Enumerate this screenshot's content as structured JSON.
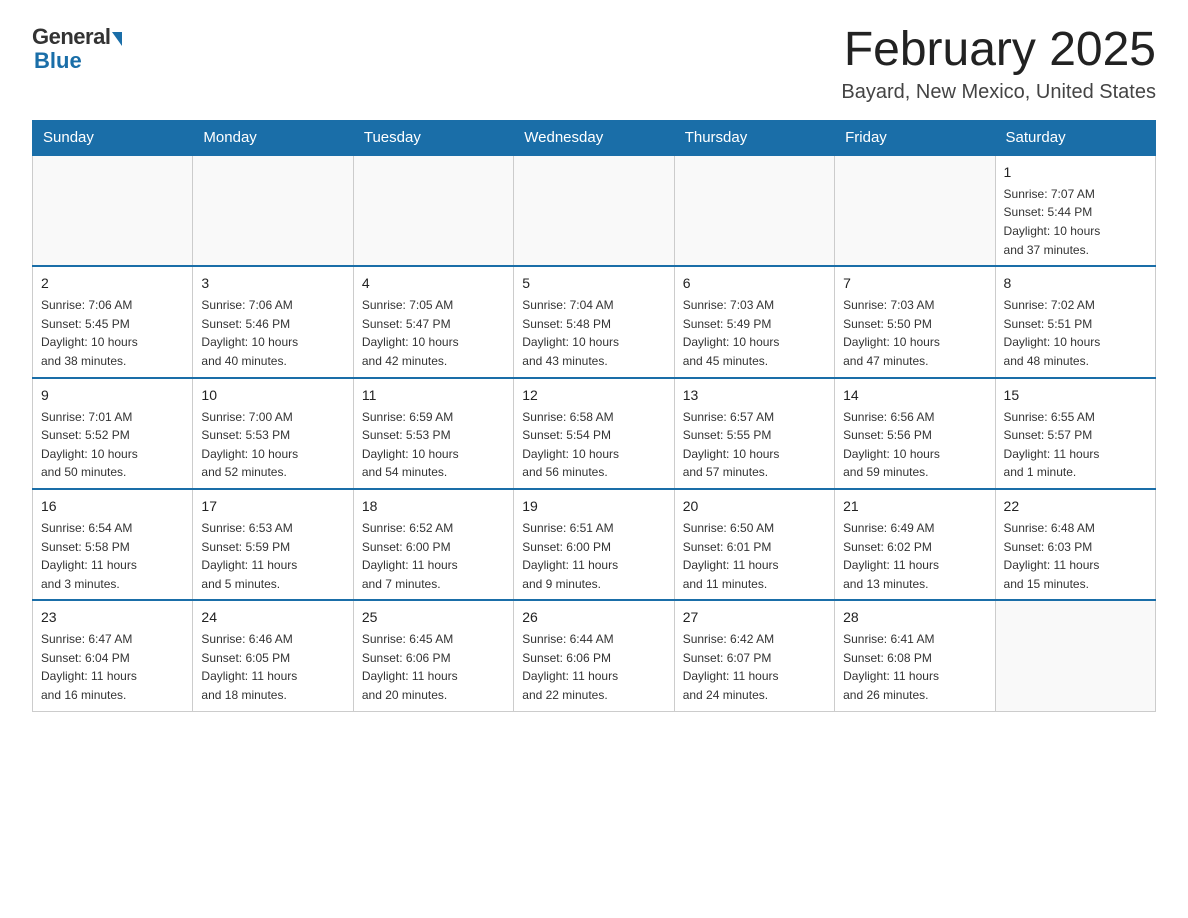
{
  "header": {
    "logo_general": "General",
    "logo_blue": "Blue",
    "title": "February 2025",
    "location": "Bayard, New Mexico, United States"
  },
  "days_of_week": [
    "Sunday",
    "Monday",
    "Tuesday",
    "Wednesday",
    "Thursday",
    "Friday",
    "Saturday"
  ],
  "weeks": [
    [
      {
        "day": "",
        "info": ""
      },
      {
        "day": "",
        "info": ""
      },
      {
        "day": "",
        "info": ""
      },
      {
        "day": "",
        "info": ""
      },
      {
        "day": "",
        "info": ""
      },
      {
        "day": "",
        "info": ""
      },
      {
        "day": "1",
        "info": "Sunrise: 7:07 AM\nSunset: 5:44 PM\nDaylight: 10 hours\nand 37 minutes."
      }
    ],
    [
      {
        "day": "2",
        "info": "Sunrise: 7:06 AM\nSunset: 5:45 PM\nDaylight: 10 hours\nand 38 minutes."
      },
      {
        "day": "3",
        "info": "Sunrise: 7:06 AM\nSunset: 5:46 PM\nDaylight: 10 hours\nand 40 minutes."
      },
      {
        "day": "4",
        "info": "Sunrise: 7:05 AM\nSunset: 5:47 PM\nDaylight: 10 hours\nand 42 minutes."
      },
      {
        "day": "5",
        "info": "Sunrise: 7:04 AM\nSunset: 5:48 PM\nDaylight: 10 hours\nand 43 minutes."
      },
      {
        "day": "6",
        "info": "Sunrise: 7:03 AM\nSunset: 5:49 PM\nDaylight: 10 hours\nand 45 minutes."
      },
      {
        "day": "7",
        "info": "Sunrise: 7:03 AM\nSunset: 5:50 PM\nDaylight: 10 hours\nand 47 minutes."
      },
      {
        "day": "8",
        "info": "Sunrise: 7:02 AM\nSunset: 5:51 PM\nDaylight: 10 hours\nand 48 minutes."
      }
    ],
    [
      {
        "day": "9",
        "info": "Sunrise: 7:01 AM\nSunset: 5:52 PM\nDaylight: 10 hours\nand 50 minutes."
      },
      {
        "day": "10",
        "info": "Sunrise: 7:00 AM\nSunset: 5:53 PM\nDaylight: 10 hours\nand 52 minutes."
      },
      {
        "day": "11",
        "info": "Sunrise: 6:59 AM\nSunset: 5:53 PM\nDaylight: 10 hours\nand 54 minutes."
      },
      {
        "day": "12",
        "info": "Sunrise: 6:58 AM\nSunset: 5:54 PM\nDaylight: 10 hours\nand 56 minutes."
      },
      {
        "day": "13",
        "info": "Sunrise: 6:57 AM\nSunset: 5:55 PM\nDaylight: 10 hours\nand 57 minutes."
      },
      {
        "day": "14",
        "info": "Sunrise: 6:56 AM\nSunset: 5:56 PM\nDaylight: 10 hours\nand 59 minutes."
      },
      {
        "day": "15",
        "info": "Sunrise: 6:55 AM\nSunset: 5:57 PM\nDaylight: 11 hours\nand 1 minute."
      }
    ],
    [
      {
        "day": "16",
        "info": "Sunrise: 6:54 AM\nSunset: 5:58 PM\nDaylight: 11 hours\nand 3 minutes."
      },
      {
        "day": "17",
        "info": "Sunrise: 6:53 AM\nSunset: 5:59 PM\nDaylight: 11 hours\nand 5 minutes."
      },
      {
        "day": "18",
        "info": "Sunrise: 6:52 AM\nSunset: 6:00 PM\nDaylight: 11 hours\nand 7 minutes."
      },
      {
        "day": "19",
        "info": "Sunrise: 6:51 AM\nSunset: 6:00 PM\nDaylight: 11 hours\nand 9 minutes."
      },
      {
        "day": "20",
        "info": "Sunrise: 6:50 AM\nSunset: 6:01 PM\nDaylight: 11 hours\nand 11 minutes."
      },
      {
        "day": "21",
        "info": "Sunrise: 6:49 AM\nSunset: 6:02 PM\nDaylight: 11 hours\nand 13 minutes."
      },
      {
        "day": "22",
        "info": "Sunrise: 6:48 AM\nSunset: 6:03 PM\nDaylight: 11 hours\nand 15 minutes."
      }
    ],
    [
      {
        "day": "23",
        "info": "Sunrise: 6:47 AM\nSunset: 6:04 PM\nDaylight: 11 hours\nand 16 minutes."
      },
      {
        "day": "24",
        "info": "Sunrise: 6:46 AM\nSunset: 6:05 PM\nDaylight: 11 hours\nand 18 minutes."
      },
      {
        "day": "25",
        "info": "Sunrise: 6:45 AM\nSunset: 6:06 PM\nDaylight: 11 hours\nand 20 minutes."
      },
      {
        "day": "26",
        "info": "Sunrise: 6:44 AM\nSunset: 6:06 PM\nDaylight: 11 hours\nand 22 minutes."
      },
      {
        "day": "27",
        "info": "Sunrise: 6:42 AM\nSunset: 6:07 PM\nDaylight: 11 hours\nand 24 minutes."
      },
      {
        "day": "28",
        "info": "Sunrise: 6:41 AM\nSunset: 6:08 PM\nDaylight: 11 hours\nand 26 minutes."
      },
      {
        "day": "",
        "info": ""
      }
    ]
  ]
}
